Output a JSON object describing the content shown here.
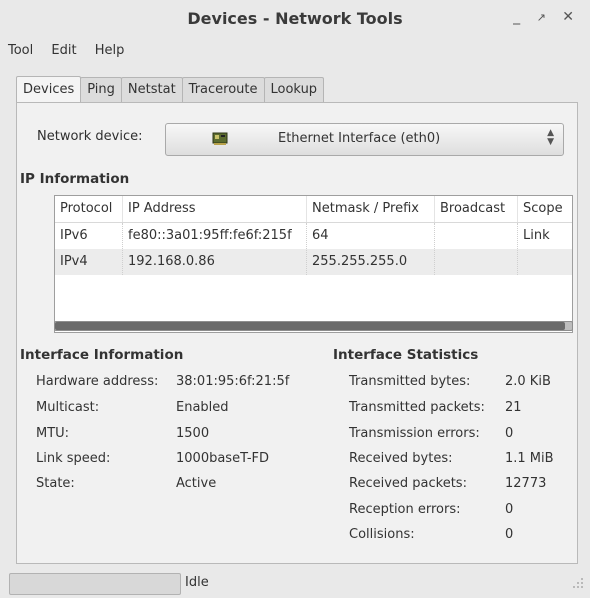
{
  "window": {
    "title": "Devices - Network Tools",
    "minimize": "_",
    "maximize": "↗",
    "close": "✕"
  },
  "menu": [
    "Tool",
    "Edit",
    "Help"
  ],
  "tabs": [
    "Devices",
    "Ping",
    "Netstat",
    "Traceroute",
    "Lookup"
  ],
  "active_tab": "Devices",
  "device": {
    "label": "Network device:",
    "value": "Ethernet Interface (eth0)",
    "icon": "ethernet-card-icon"
  },
  "ip_info": {
    "heading": "IP Information",
    "columns": [
      "Protocol",
      "IP Address",
      "Netmask / Prefix",
      "Broadcast",
      "Scope"
    ],
    "rows": [
      [
        "IPv6",
        "fe80::3a01:95ff:fe6f:215f",
        "64",
        "",
        "Link"
      ],
      [
        "IPv4",
        "192.168.0.86",
        "255.255.255.0",
        "",
        ""
      ]
    ]
  },
  "interface_info": {
    "heading": "Interface Information",
    "items": [
      {
        "label": "Hardware address:",
        "value": "38:01:95:6f:21:5f"
      },
      {
        "label": "Multicast:",
        "value": "Enabled"
      },
      {
        "label": "MTU:",
        "value": "1500"
      },
      {
        "label": "Link speed:",
        "value": "1000baseT-FD"
      },
      {
        "label": "State:",
        "value": "Active"
      }
    ]
  },
  "interface_stats": {
    "heading": "Interface Statistics",
    "items": [
      {
        "label": "Transmitted bytes:",
        "value": "2.0 KiB"
      },
      {
        "label": "Transmitted packets:",
        "value": "21"
      },
      {
        "label": "Transmission errors:",
        "value": "0"
      },
      {
        "label": "Received bytes:",
        "value": "1.1 MiB"
      },
      {
        "label": "Received packets:",
        "value": "12773"
      },
      {
        "label": "Reception errors:",
        "value": "0"
      },
      {
        "label": "Collisions:",
        "value": "0"
      }
    ]
  },
  "status": {
    "text": "Idle",
    "progress": 0
  },
  "colors": {
    "window_bg": "#e9e9e9",
    "panel_bg": "#f1f1f1",
    "scroll_thumb": "#6a6a6a"
  }
}
